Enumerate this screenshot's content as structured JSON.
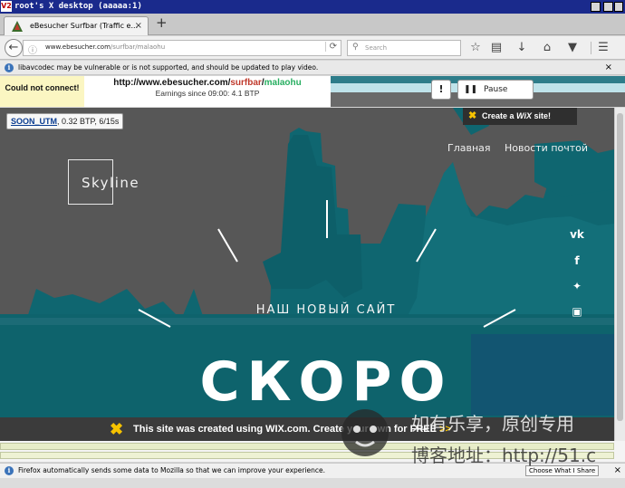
{
  "x_window": {
    "title": "root's X desktop (aaaaa:1)",
    "vnc_badge": "V2"
  },
  "tab": {
    "label": "eBesucher Surfbar (Traffic e...",
    "close": "×",
    "new_tab": "+"
  },
  "navbar": {
    "url_host": "www.ebesucher.com",
    "url_path": "/surfbar/malaohu",
    "search_placeholder": "Search",
    "reload_icon": "reload-icon",
    "toolbar_icons": [
      "star-icon",
      "clipboard-icon",
      "download-icon",
      "home-icon",
      "pocket-icon",
      "menu-icon"
    ]
  },
  "notification": {
    "text": "libavcodec may be vulnerable or is not supported, and should be updated to play video.",
    "close": "×"
  },
  "surfbar": {
    "status": "Could not connect!",
    "url_prefix": "http://www.ebesucher.com/",
    "url_mid": "surfbar",
    "url_sep": "/",
    "url_user": "malaohu",
    "earnings": "Earnings since 09:00: 4.1 BTP",
    "flag_label": "!",
    "pause_label": "Pause"
  },
  "site": {
    "soon_link": "SOON_UTM",
    "soon_rest": ", 0.32 BTP, 6/15s",
    "create_wix_prefix": "Create a",
    "create_wix_brand": "WiX",
    "create_wix_suffix": "site!",
    "logo": "Skyline",
    "nav": [
      "Главная",
      "Новости почтой"
    ],
    "social": [
      "vk-icon",
      "facebook-icon",
      "twitter-icon",
      "instagram-icon"
    ],
    "subtitle": "НАШ НОВЫЙ САЙТ",
    "headline": "СКОРО",
    "wix_banner": "This site was created using WIX.com. Create your own for FREE",
    "wix_arrows": ">>"
  },
  "status_bar": {
    "text": "Firefox automatically sends some data to Mozilla so that we can improve your experience.",
    "button": "Choose What I Share",
    "close": "×"
  },
  "watermark": {
    "line1": "如有乐享，原创专用",
    "line2": "博客地址：http://51.c"
  },
  "colors": {
    "site_teal": "#0f6670",
    "site_gray": "#575757",
    "wix_yellow": "#f6c200",
    "xtitle_blue": "#1a2a8c"
  }
}
